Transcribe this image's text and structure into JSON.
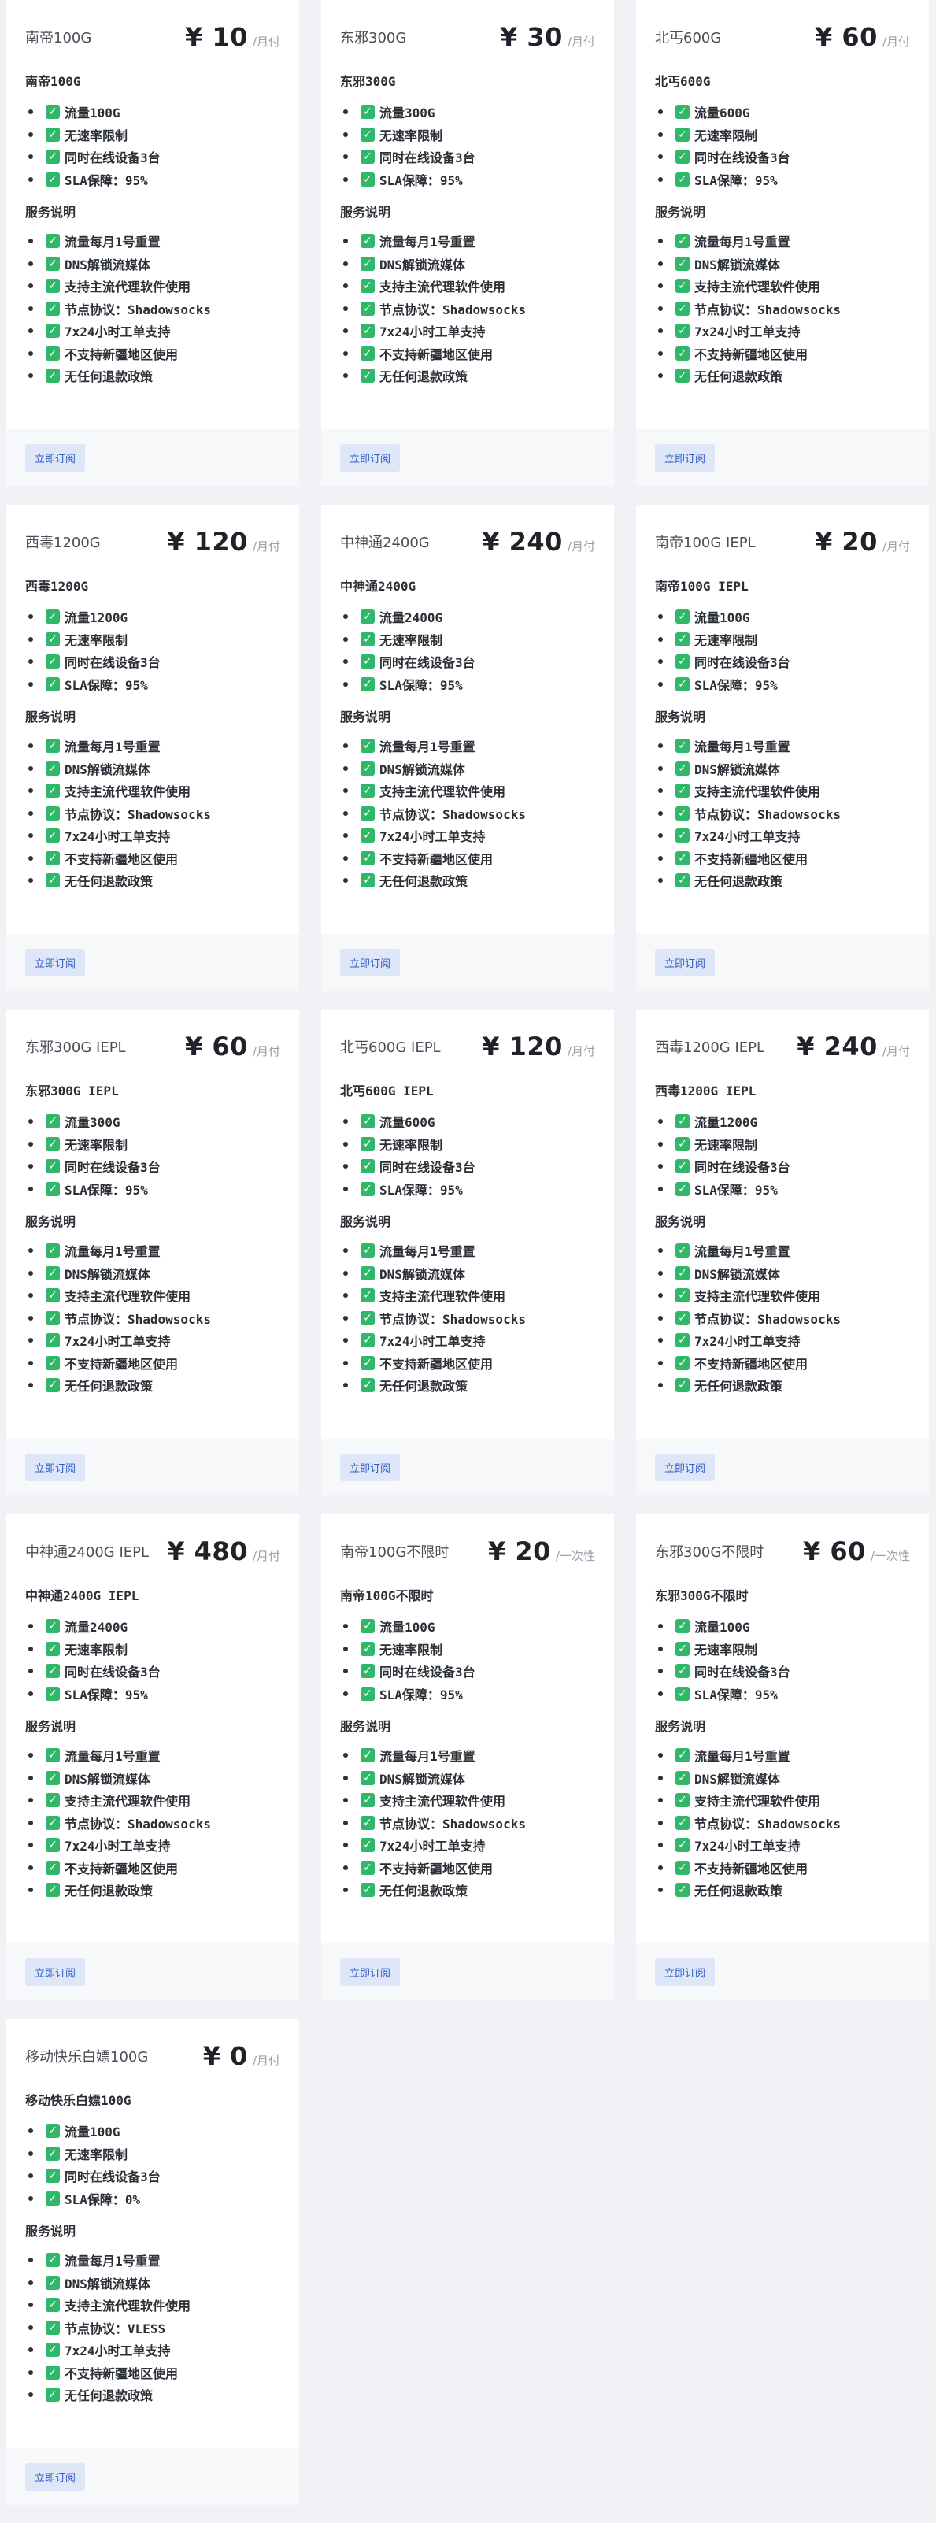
{
  "plans": [
    {
      "name": "南帝100G",
      "price": "¥ 10",
      "period": "/月付",
      "desc": "南帝100G",
      "features": [
        "流量100G",
        "无速率限制",
        "同时在线设备3台",
        "SLA保障：95%"
      ],
      "section": "服务说明",
      "services": [
        "流量每月1号重置",
        "DNS解锁流媒体",
        "支持主流代理软件使用",
        "节点协议：Shadowsocks",
        "7x24小时工单支持",
        "不支持新疆地区使用",
        "无任何退款政策"
      ],
      "button": "立即订阅"
    },
    {
      "name": "东邪300G",
      "price": "¥ 30",
      "period": "/月付",
      "desc": "东邪300G",
      "features": [
        "流量300G",
        "无速率限制",
        "同时在线设备3台",
        "SLA保障：95%"
      ],
      "section": "服务说明",
      "services": [
        "流量每月1号重置",
        "DNS解锁流媒体",
        "支持主流代理软件使用",
        "节点协议：Shadowsocks",
        "7x24小时工单支持",
        "不支持新疆地区使用",
        "无任何退款政策"
      ],
      "button": "立即订阅"
    },
    {
      "name": "北丐600G",
      "price": "¥ 60",
      "period": "/月付",
      "desc": "北丐600G",
      "features": [
        "流量600G",
        "无速率限制",
        "同时在线设备3台",
        "SLA保障：95%"
      ],
      "section": "服务说明",
      "services": [
        "流量每月1号重置",
        "DNS解锁流媒体",
        "支持主流代理软件使用",
        "节点协议：Shadowsocks",
        "7x24小时工单支持",
        "不支持新疆地区使用",
        "无任何退款政策"
      ],
      "button": "立即订阅"
    },
    {
      "name": "西毒1200G",
      "price": "¥ 120",
      "period": "/月付",
      "desc": "西毒1200G",
      "features": [
        "流量1200G",
        "无速率限制",
        "同时在线设备3台",
        "SLA保障：95%"
      ],
      "section": "服务说明",
      "services": [
        "流量每月1号重置",
        "DNS解锁流媒体",
        "支持主流代理软件使用",
        "节点协议：Shadowsocks",
        "7x24小时工单支持",
        "不支持新疆地区使用",
        "无任何退款政策"
      ],
      "button": "立即订阅"
    },
    {
      "name": "中神通2400G",
      "price": "¥ 240",
      "period": "/月付",
      "desc": "中神通2400G",
      "features": [
        "流量2400G",
        "无速率限制",
        "同时在线设备3台",
        "SLA保障：95%"
      ],
      "section": "服务说明",
      "services": [
        "流量每月1号重置",
        "DNS解锁流媒体",
        "支持主流代理软件使用",
        "节点协议：Shadowsocks",
        "7x24小时工单支持",
        "不支持新疆地区使用",
        "无任何退款政策"
      ],
      "button": "立即订阅"
    },
    {
      "name": "南帝100G IEPL",
      "price": "¥ 20",
      "period": "/月付",
      "desc": "南帝100G IEPL",
      "features": [
        "流量100G",
        "无速率限制",
        "同时在线设备3台",
        "SLA保障：95%"
      ],
      "section": "服务说明",
      "services": [
        "流量每月1号重置",
        "DNS解锁流媒体",
        "支持主流代理软件使用",
        "节点协议：Shadowsocks",
        "7x24小时工单支持",
        "不支持新疆地区使用",
        "无任何退款政策"
      ],
      "button": "立即订阅"
    },
    {
      "name": "东邪300G IEPL",
      "price": "¥ 60",
      "period": "/月付",
      "desc": "东邪300G IEPL",
      "features": [
        "流量300G",
        "无速率限制",
        "同时在线设备3台",
        "SLA保障：95%"
      ],
      "section": "服务说明",
      "services": [
        "流量每月1号重置",
        "DNS解锁流媒体",
        "支持主流代理软件使用",
        "节点协议：Shadowsocks",
        "7x24小时工单支持",
        "不支持新疆地区使用",
        "无任何退款政策"
      ],
      "button": "立即订阅"
    },
    {
      "name": "北丐600G IEPL",
      "price": "¥ 120",
      "period": "/月付",
      "desc": "北丐600G IEPL",
      "features": [
        "流量600G",
        "无速率限制",
        "同时在线设备3台",
        "SLA保障：95%"
      ],
      "section": "服务说明",
      "services": [
        "流量每月1号重置",
        "DNS解锁流媒体",
        "支持主流代理软件使用",
        "节点协议：Shadowsocks",
        "7x24小时工单支持",
        "不支持新疆地区使用",
        "无任何退款政策"
      ],
      "button": "立即订阅"
    },
    {
      "name": "西毒1200G IEPL",
      "price": "¥ 240",
      "period": "/月付",
      "desc": "西毒1200G IEPL",
      "features": [
        "流量1200G",
        "无速率限制",
        "同时在线设备3台",
        "SLA保障：95%"
      ],
      "section": "服务说明",
      "services": [
        "流量每月1号重置",
        "DNS解锁流媒体",
        "支持主流代理软件使用",
        "节点协议：Shadowsocks",
        "7x24小时工单支持",
        "不支持新疆地区使用",
        "无任何退款政策"
      ],
      "button": "立即订阅"
    },
    {
      "name": "中神通2400G IEPL",
      "price": "¥ 480",
      "period": "/月付",
      "desc": "中神通2400G IEPL",
      "features": [
        "流量2400G",
        "无速率限制",
        "同时在线设备3台",
        "SLA保障：95%"
      ],
      "section": "服务说明",
      "services": [
        "流量每月1号重置",
        "DNS解锁流媒体",
        "支持主流代理软件使用",
        "节点协议：Shadowsocks",
        "7x24小时工单支持",
        "不支持新疆地区使用",
        "无任何退款政策"
      ],
      "button": "立即订阅"
    },
    {
      "name": "南帝100G不限时",
      "price": "¥ 20",
      "period": "/一次性",
      "desc": "南帝100G不限时",
      "features": [
        "流量100G",
        "无速率限制",
        "同时在线设备3台",
        "SLA保障：95%"
      ],
      "section": "服务说明",
      "services": [
        "流量每月1号重置",
        "DNS解锁流媒体",
        "支持主流代理软件使用",
        "节点协议：Shadowsocks",
        "7x24小时工单支持",
        "不支持新疆地区使用",
        "无任何退款政策"
      ],
      "button": "立即订阅"
    },
    {
      "name": "东邪300G不限时",
      "price": "¥ 60",
      "period": "/一次性",
      "desc": "东邪300G不限时",
      "features": [
        "流量100G",
        "无速率限制",
        "同时在线设备3台",
        "SLA保障：95%"
      ],
      "section": "服务说明",
      "services": [
        "流量每月1号重置",
        "DNS解锁流媒体",
        "支持主流代理软件使用",
        "节点协议：Shadowsocks",
        "7x24小时工单支持",
        "不支持新疆地区使用",
        "无任何退款政策"
      ],
      "button": "立即订阅"
    },
    {
      "name": "移动快乐白嫖100G",
      "price": "¥ 0",
      "period": "/月付",
      "desc": "移动快乐白嫖100G",
      "features": [
        "流量100G",
        "无速率限制",
        "同时在线设备3台",
        "SLA保障：0%"
      ],
      "section": "服务说明",
      "services": [
        "流量每月1号重置",
        "DNS解锁流媒体",
        "支持主流代理软件使用",
        "节点协议：VLESS",
        "7x24小时工单支持",
        "不支持新疆地区使用",
        "无任何退款政策"
      ],
      "button": "立即订阅"
    }
  ]
}
